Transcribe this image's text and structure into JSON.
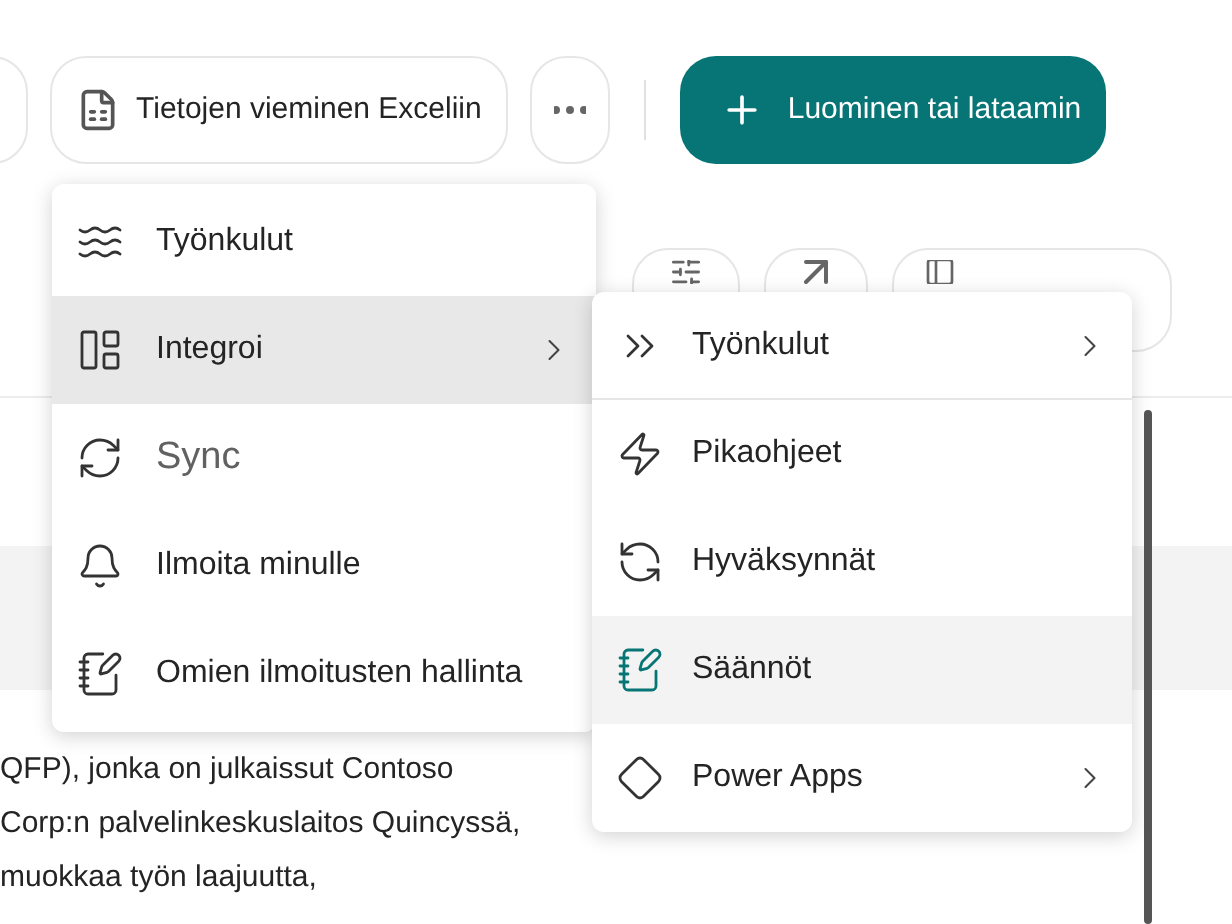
{
  "toolbar": {
    "export_button": "Tietojen vieminen Exceliin",
    "create_button": "Luominen tai lataamin"
  },
  "menu": {
    "items": [
      {
        "label": "Työnkulut",
        "selected": false,
        "disabled": false,
        "has_submenu": false
      },
      {
        "label": "Integroi",
        "selected": true,
        "disabled": false,
        "has_submenu": true
      },
      {
        "label": "Sync",
        "selected": false,
        "disabled": true,
        "has_submenu": false
      },
      {
        "label": "Ilmoita minulle",
        "selected": false,
        "disabled": false,
        "has_submenu": false
      },
      {
        "label": "Omien ilmoitusten hallinta",
        "selected": false,
        "disabled": false,
        "has_submenu": false
      }
    ]
  },
  "submenu": {
    "items": [
      {
        "label": "Työnkulut",
        "selected": false,
        "has_submenu": true
      },
      {
        "label": "Pikaohjeet",
        "selected": false,
        "has_submenu": false
      },
      {
        "label": "Hyväksynnät",
        "selected": false,
        "has_submenu": false
      },
      {
        "label": "Säännöt",
        "selected": true,
        "has_submenu": false
      },
      {
        "label": "Power Apps",
        "selected": false,
        "has_submenu": true
      }
    ]
  },
  "body_lines": [
    "QFP), jonka on julkaissut Contoso",
    "Corp:n palvelinkeskuslaitos Quincyssä,",
    "muokkaa työn laajuutta,"
  ]
}
